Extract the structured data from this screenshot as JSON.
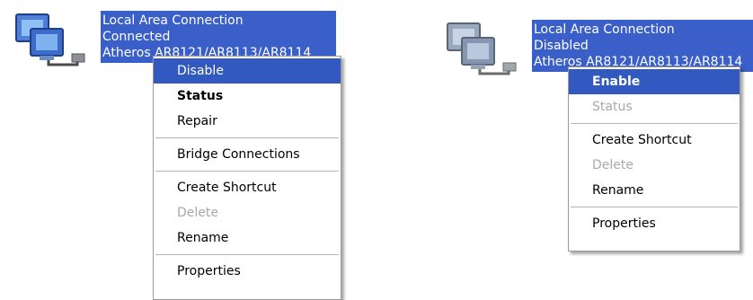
{
  "left": {
    "connection": {
      "name": "Local Area Connection",
      "status": "Connected",
      "device": "Atheros AR8121/AR8113/AR8114"
    },
    "menu": {
      "disable": "Disable",
      "status": "Status",
      "repair": "Repair",
      "bridge": "Bridge Connections",
      "create_shortcut": "Create Shortcut",
      "delete": "Delete",
      "rename": "Rename",
      "properties": "Properties"
    }
  },
  "right": {
    "connection": {
      "name": "Local Area Connection",
      "status": "Disabled",
      "device": "Atheros AR8121/AR8113/AR8114"
    },
    "menu": {
      "enable": "Enable",
      "status": "Status",
      "create_shortcut": "Create Shortcut",
      "delete": "Delete",
      "rename": "Rename",
      "properties": "Properties"
    }
  },
  "colors": {
    "selection": "#3b5fc9",
    "menu_highlight": "#3159c0",
    "disabled_text": "#a8a8a8"
  },
  "icons": [
    "network-connection-icon",
    "network-connection-icon"
  ]
}
